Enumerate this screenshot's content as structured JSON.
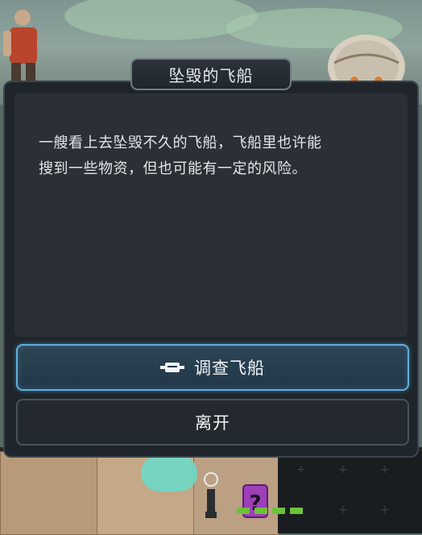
{
  "dialog": {
    "title": "坠毁的飞船",
    "description_line1": "一艘看上去坠毁不久的飞船，飞船里也许能",
    "description_line2": "搜到一些物资，但也可能有一定的风险。",
    "actions": [
      {
        "label": "调查飞船",
        "icon": "ship-icon",
        "style": "primary"
      },
      {
        "label": "离开",
        "style": "secondary"
      }
    ]
  },
  "colors": {
    "panel_bg": "#1f252b",
    "primary_border": "#5fb0dc",
    "text": "#e4e6e8"
  }
}
